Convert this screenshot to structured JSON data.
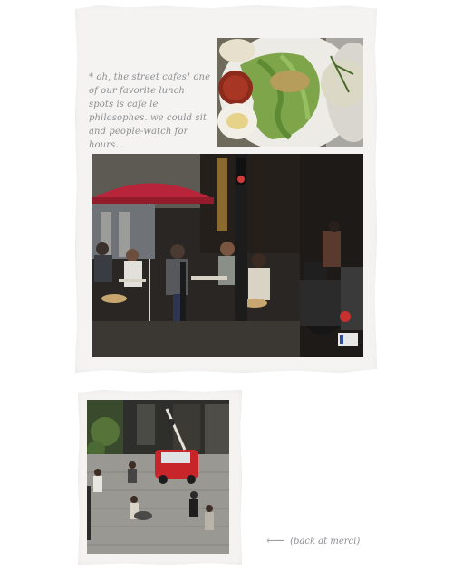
{
  "caption": "* oh, the street cafes! one of our favorite lunch spots is cafe le philosophes. we could sit and people-watch for hours...",
  "note": "(back at merci)",
  "note_arrow_icon": "left-arrow-icon",
  "colors": {
    "paper": "#f4f3f1",
    "text": "#8d8f93",
    "umbrella": "#b8253a",
    "car": "#c8252a"
  }
}
